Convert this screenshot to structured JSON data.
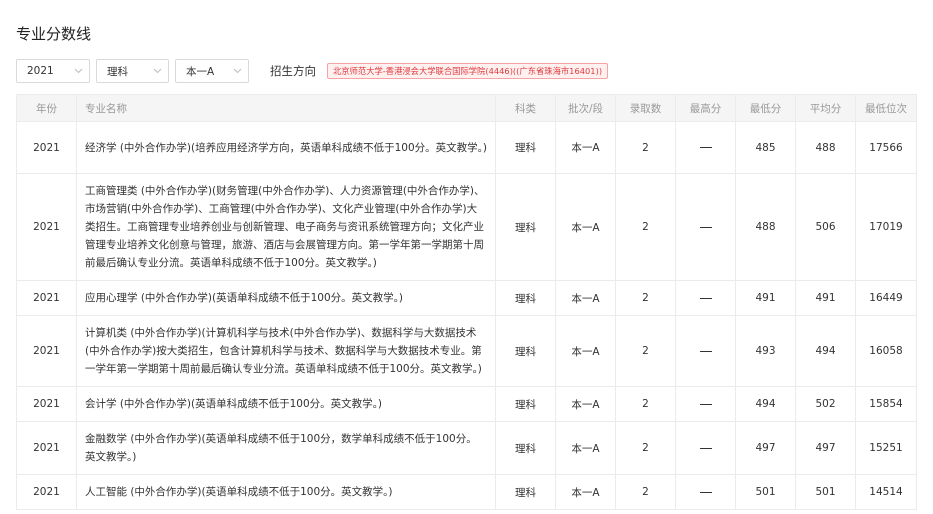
{
  "page": {
    "title": "专业分数线"
  },
  "filters": {
    "year": "2021",
    "subject": "理科",
    "batch": "本一A",
    "direction_label": "招生方向",
    "direction_tag": "北京师范大学-香港浸会大学联合国际学院(4446)((广东省珠海市16401))"
  },
  "table": {
    "headers": {
      "year": "年份",
      "name": "专业名称",
      "subject": "科类",
      "batch": "批次/段",
      "admitted": "录取数",
      "max": "最高分",
      "min": "最低分",
      "avg": "平均分",
      "rank": "最低位次"
    },
    "rows": [
      {
        "year": "2021",
        "name": "经济学 (中外合作办学)(培养应用经济学方向，英语单科成绩不低于100分。英文教学。)",
        "subject": "理科",
        "batch": "本一A",
        "admitted": "2",
        "min": "485",
        "avg": "488",
        "rank": "17566"
      },
      {
        "year": "2021",
        "name": "工商管理类 (中外合作办学)(财务管理(中外合作办学)、人力资源管理(中外合作办学)、市场营销(中外合作办学)、工商管理(中外合作办学)、文化产业管理(中外合作办学)大类招生。工商管理专业培养创业与创新管理、电子商务与资讯系统管理方向；文化产业管理专业培养文化创意与管理，旅游、酒店与会展管理方向。第一学年第一学期第十周前最后确认专业分流。英语单科成绩不低于100分。英文教学。)",
        "subject": "理科",
        "batch": "本一A",
        "admitted": "2",
        "min": "488",
        "avg": "506",
        "rank": "17019"
      },
      {
        "year": "2021",
        "name": "应用心理学 (中外合作办学)(英语单科成绩不低于100分。英文教学。)",
        "subject": "理科",
        "batch": "本一A",
        "admitted": "2",
        "min": "491",
        "avg": "491",
        "rank": "16449"
      },
      {
        "year": "2021",
        "name": "计算机类 (中外合作办学)(计算机科学与技术(中外合作办学)、数据科学与大数据技术(中外合作办学)按大类招生，包含计算机科学与技术、数据科学与大数据技术专业。第一学年第一学期第十周前最后确认专业分流。英语单科成绩不低于100分。英文教学。)",
        "subject": "理科",
        "batch": "本一A",
        "admitted": "2",
        "min": "493",
        "avg": "494",
        "rank": "16058"
      },
      {
        "year": "2021",
        "name": "会计学 (中外合作办学)(英语单科成绩不低于100分。英文教学。)",
        "subject": "理科",
        "batch": "本一A",
        "admitted": "2",
        "min": "494",
        "avg": "502",
        "rank": "15854"
      },
      {
        "year": "2021",
        "name": "金融数学 (中外合作办学)(英语单科成绩不低于100分，数学单科成绩不低于100分。英文教学。)",
        "subject": "理科",
        "batch": "本一A",
        "admitted": "2",
        "min": "497",
        "avg": "497",
        "rank": "15251"
      },
      {
        "year": "2021",
        "name": "人工智能 (中外合作办学)(英语单科成绩不低于100分。英文教学。)",
        "subject": "理科",
        "batch": "本一A",
        "admitted": "2",
        "min": "501",
        "avg": "501",
        "rank": "14514"
      }
    ]
  }
}
